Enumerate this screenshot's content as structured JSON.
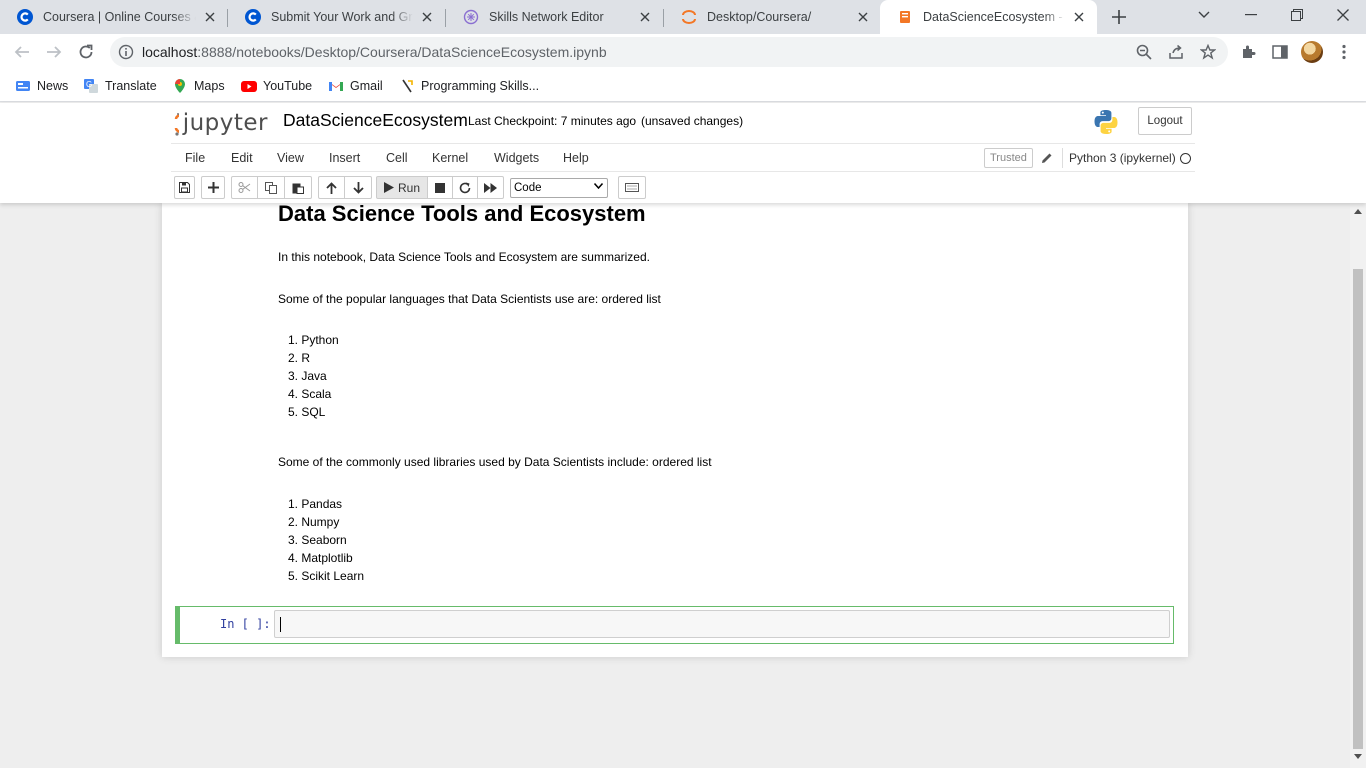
{
  "browser": {
    "tabs": [
      {
        "title": "Coursera | Online Courses & Credentials From Top Educators",
        "icon": "coursera-icon",
        "active": false
      },
      {
        "title": "Submit Your Work and Grade Your Peers",
        "icon": "coursera-icon",
        "active": false
      },
      {
        "title": "Skills Network Editor",
        "icon": "skills-network-icon",
        "active": false
      },
      {
        "title": "Desktop/Coursera/",
        "icon": "jupyter-icon",
        "active": false
      },
      {
        "title": "DataScienceEcosystem - Jupyter Notebook",
        "icon": "notebook-icon",
        "active": true
      }
    ],
    "url_host": "localhost",
    "url_rest": ":8888/notebooks/Desktop/Coursera/DataScienceEcosystem.ipynb",
    "bookmarks": [
      {
        "label": "News",
        "icon": "news-icon"
      },
      {
        "label": "Translate",
        "icon": "translate-icon"
      },
      {
        "label": "Maps",
        "icon": "maps-icon"
      },
      {
        "label": "YouTube",
        "icon": "youtube-icon"
      },
      {
        "label": "Gmail",
        "icon": "gmail-icon"
      },
      {
        "label": "Programming Skills...",
        "icon": "programming-icon"
      }
    ]
  },
  "jupyter": {
    "logo_text": "jupyter",
    "notebook_name": "DataScienceEcosystem",
    "checkpoint": "Last Checkpoint: 7 minutes ago",
    "autosave_status": "(unsaved changes)",
    "logout_label": "Logout",
    "menu": [
      "File",
      "Edit",
      "View",
      "Insert",
      "Cell",
      "Kernel",
      "Widgets",
      "Help"
    ],
    "trusted_label": "Trusted",
    "kernel_name": "Python 3 (ipykernel)",
    "run_label": "Run",
    "cell_type": "Code"
  },
  "notebook": {
    "heading": "Data Science Tools and Ecosystem",
    "intro": "In this notebook, Data Science Tools and Ecosystem are summarized.",
    "languages_intro": "Some of the popular languages that Data Scientists use are: ordered list",
    "languages": [
      "1. Python",
      "2. R",
      "3. Java",
      "4. Scala",
      "5. SQL"
    ],
    "libraries_intro": "Some of the commonly used libraries used by Data Scientists include: ordered list",
    "libraries": [
      "1. Pandas",
      "2. Numpy",
      "3. Seaborn",
      "4. Matplotlib",
      "5. Scikit Learn"
    ],
    "code_prompt": "In [ ]:",
    "code_value": ""
  },
  "colors": {
    "selected_cell_border": "#66bb6a",
    "prompt_color": "#303f9f",
    "accent_tab_bg": "#ffffff",
    "tabstrip_bg": "#dee1e6"
  }
}
